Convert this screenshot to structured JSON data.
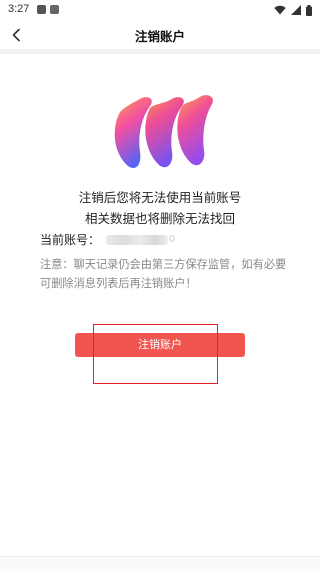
{
  "status_bar": {
    "time": "3:27",
    "icons": [
      "app-notification-icon",
      "app-a-icon",
      "wifi-icon",
      "signal-icon",
      "battery-icon"
    ]
  },
  "nav": {
    "back_icon": "back-chevron-icon",
    "title": "注销账户"
  },
  "logo": {
    "icon": "brand-gradient-logo",
    "colors": [
      "#ff8a3d",
      "#f2409a",
      "#8b3cf0",
      "#4a55f5"
    ]
  },
  "message": {
    "line1": "注销后您将无法使用当前账号",
    "line2": "相关数据也将删除无法找回"
  },
  "account": {
    "label": "当前账号：",
    "value_tail": "0"
  },
  "notice": "注意：聊天记录仍会由第三方保存监管，如有必要可删除消息列表后再注销账户！",
  "button": {
    "label": "注销账户",
    "color": "#f0564f"
  },
  "highlight": {
    "color": "#e8202a"
  }
}
